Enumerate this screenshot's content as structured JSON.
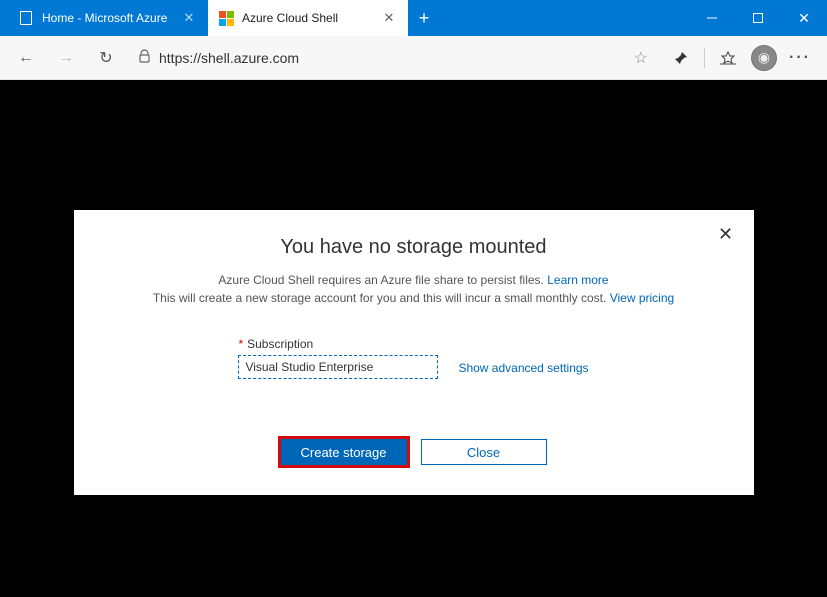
{
  "browser": {
    "tabs": [
      {
        "label": "Home - Microsoft Azure",
        "active": false
      },
      {
        "label": "Azure Cloud Shell",
        "active": true
      }
    ],
    "url": "https://shell.azure.com"
  },
  "modal": {
    "title": "You have no storage mounted",
    "line1_prefix": "Azure Cloud Shell requires an Azure file share to persist files. ",
    "line1_link": "Learn more",
    "line2_prefix": "This will create a new storage account for you and this will incur a small monthly cost. ",
    "line2_link": "View pricing",
    "subscription_label": "Subscription",
    "subscription_value": "Visual Studio Enterprise",
    "advanced_link": "Show advanced settings",
    "create_button": "Create storage",
    "close_button": "Close"
  }
}
